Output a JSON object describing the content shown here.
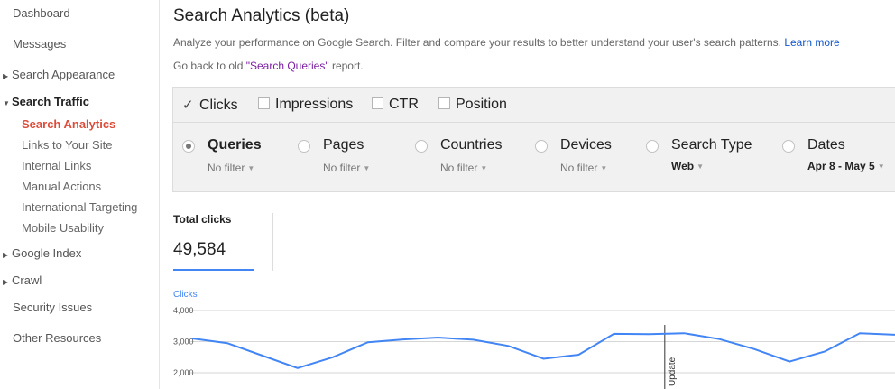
{
  "sidebar": {
    "dashboard": "Dashboard",
    "messages": "Messages",
    "search_appearance": "Search Appearance",
    "search_traffic": "Search Traffic",
    "sub": {
      "search_analytics": "Search Analytics",
      "links": "Links to Your Site",
      "internal_links": "Internal Links",
      "manual_actions": "Manual Actions",
      "intl_targeting": "International Targeting",
      "mobile_usability": "Mobile Usability"
    },
    "google_index": "Google Index",
    "crawl": "Crawl",
    "security": "Security Issues",
    "other": "Other Resources"
  },
  "page": {
    "title": "Search Analytics (beta)",
    "description": "Analyze your performance on Google Search. Filter and compare your results to better understand your user's search patterns.",
    "learn_more": "Learn more",
    "old_prefix": "Go back to old ",
    "old_link": "\"Search Queries\"",
    "old_suffix": " report."
  },
  "metrics": {
    "clicks": {
      "label": "Clicks",
      "checked": true
    },
    "impressions": {
      "label": "Impressions",
      "checked": false
    },
    "ctr": {
      "label": "CTR",
      "checked": false
    },
    "position": {
      "label": "Position",
      "checked": false
    }
  },
  "filters": {
    "queries": {
      "label": "Queries",
      "value": "No filter"
    },
    "pages": {
      "label": "Pages",
      "value": "No filter"
    },
    "countries": {
      "label": "Countries",
      "value": "No filter"
    },
    "devices": {
      "label": "Devices",
      "value": "No filter"
    },
    "search_type": {
      "label": "Search Type",
      "value": "Web"
    },
    "dates": {
      "label": "Dates",
      "value": "Apr 8 - May 5"
    }
  },
  "total": {
    "label": "Total clicks",
    "value": "49,584"
  },
  "chart_data": {
    "type": "line",
    "title": "Clicks",
    "ylabel": "Clicks",
    "yticks": [
      "4,000",
      "3,000",
      "2,000"
    ],
    "ylim": [
      2000,
      4000
    ],
    "grid": true,
    "annotation": "Update",
    "annotation_index": 14,
    "series": [
      {
        "name": "Clicks",
        "color": "#4285f4",
        "values": [
          3100,
          2950,
          2550,
          2150,
          2500,
          2980,
          3070,
          3130,
          3060,
          2860,
          2450,
          2580,
          3250,
          3240,
          3270,
          3080,
          2760,
          2360,
          2680,
          3270,
          3220
        ]
      }
    ]
  }
}
